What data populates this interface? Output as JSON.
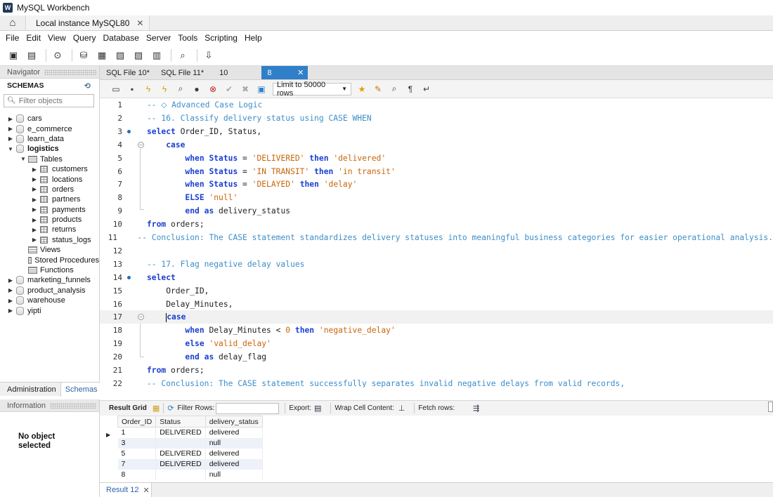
{
  "window": {
    "title": "MySQL Workbench"
  },
  "connection_tab": {
    "label": "Local instance MySQL80",
    "close": "✕"
  },
  "menu": [
    "File",
    "Edit",
    "View",
    "Query",
    "Database",
    "Server",
    "Tools",
    "Scripting",
    "Help"
  ],
  "navigator": {
    "header": "Navigator",
    "schemas_label": "SCHEMAS",
    "filter_placeholder": "Filter objects",
    "schemas": [
      {
        "name": "cars",
        "expanded": false
      },
      {
        "name": "e_commerce",
        "expanded": false
      },
      {
        "name": "learn_data",
        "expanded": false
      },
      {
        "name": "logistics",
        "expanded": true
      },
      {
        "name": "marketing_funnels",
        "expanded": false
      },
      {
        "name": "product_analysis",
        "expanded": false
      },
      {
        "name": "warehouse",
        "expanded": false
      },
      {
        "name": "yipti",
        "expanded": false
      }
    ],
    "logistics": {
      "tables_label": "Tables",
      "tables": [
        "customers",
        "locations",
        "orders",
        "partners",
        "payments",
        "products",
        "returns",
        "status_logs"
      ],
      "views_label": "Views",
      "procedures_label": "Stored Procedures",
      "functions_label": "Functions"
    }
  },
  "nav_tabs": {
    "administration": "Administration",
    "schemas": "Schemas"
  },
  "information": {
    "header": "Information",
    "line1": "No object",
    "line2": "selected"
  },
  "editor_tabs": [
    {
      "label": "SQL File 10*",
      "active": false
    },
    {
      "label": "SQL File 11*",
      "active": false
    },
    {
      "label": "10",
      "active": false
    },
    {
      "label": "8",
      "active": true
    }
  ],
  "editor_tab_close": "✕",
  "editor_toolbar": {
    "limit_label": "Limit to 50000 rows"
  },
  "code_lines": [
    {
      "n": "1",
      "tokens": [
        [
          "cm",
          "-- ⬦ Advanced Case Logic"
        ]
      ]
    },
    {
      "n": "2",
      "tokens": [
        [
          "cm",
          "-- 16. Classify delivery status using CASE WHEN"
        ]
      ]
    },
    {
      "n": "3",
      "dot": true,
      "tokens": [
        [
          "kw",
          "select"
        ],
        [
          "id",
          " Order_ID, Status,"
        ]
      ]
    },
    {
      "n": "4",
      "fold": true,
      "tokens": [
        [
          "id",
          "    "
        ],
        [
          "kw",
          "case"
        ]
      ]
    },
    {
      "n": "5",
      "tokens": [
        [
          "id",
          "        "
        ],
        [
          "kw",
          "when"
        ],
        [
          "kw",
          " Status"
        ],
        [
          "id",
          " = "
        ],
        [
          "str",
          "'DELIVERED'"
        ],
        [
          "id",
          " "
        ],
        [
          "kw",
          "then"
        ],
        [
          "id",
          " "
        ],
        [
          "str",
          "'delivered'"
        ]
      ]
    },
    {
      "n": "6",
      "tokens": [
        [
          "id",
          "        "
        ],
        [
          "kw",
          "when"
        ],
        [
          "kw",
          " Status"
        ],
        [
          "id",
          " = "
        ],
        [
          "str",
          "'IN TRANSIT'"
        ],
        [
          "id",
          " "
        ],
        [
          "kw",
          "then"
        ],
        [
          "id",
          " "
        ],
        [
          "str",
          "'in transit'"
        ]
      ]
    },
    {
      "n": "7",
      "tokens": [
        [
          "id",
          "        "
        ],
        [
          "kw",
          "when"
        ],
        [
          "kw",
          " Status"
        ],
        [
          "id",
          " = "
        ],
        [
          "str",
          "'DELAYED'"
        ],
        [
          "id",
          " "
        ],
        [
          "kw",
          "then"
        ],
        [
          "id",
          " "
        ],
        [
          "str",
          "'delay'"
        ]
      ]
    },
    {
      "n": "8",
      "tokens": [
        [
          "id",
          "        "
        ],
        [
          "kw",
          "ELSE"
        ],
        [
          "id",
          " "
        ],
        [
          "str",
          "'null'"
        ]
      ]
    },
    {
      "n": "9",
      "tokens": [
        [
          "id",
          "        "
        ],
        [
          "kw",
          "end"
        ],
        [
          "id",
          " "
        ],
        [
          "kw",
          "as"
        ],
        [
          "id",
          " delivery_status"
        ]
      ]
    },
    {
      "n": "10",
      "tokens": [
        [
          "kw",
          "from"
        ],
        [
          "id",
          " orders;"
        ]
      ]
    },
    {
      "n": "11",
      "tokens": [
        [
          "cm",
          "-- Conclusion: The CASE statement standardizes delivery statuses into meaningful business categories for easier operational analysis."
        ]
      ]
    },
    {
      "n": "12",
      "tokens": []
    },
    {
      "n": "13",
      "tokens": [
        [
          "cm",
          "-- 17. Flag negative delay values"
        ]
      ]
    },
    {
      "n": "14",
      "dot": true,
      "tokens": [
        [
          "kw",
          "select"
        ]
      ]
    },
    {
      "n": "15",
      "tokens": [
        [
          "id",
          "    Order_ID,"
        ]
      ]
    },
    {
      "n": "16",
      "tokens": [
        [
          "id",
          "    Delay_Minutes,"
        ]
      ]
    },
    {
      "n": "17",
      "fold": true,
      "current": true,
      "caret": true,
      "tokens": [
        [
          "id",
          "    "
        ],
        [
          "kw",
          "case"
        ]
      ]
    },
    {
      "n": "18",
      "tokens": [
        [
          "id",
          "        "
        ],
        [
          "kw",
          "when"
        ],
        [
          "id",
          " Delay_Minutes < "
        ],
        [
          "num",
          "0"
        ],
        [
          "id",
          " "
        ],
        [
          "kw",
          "then"
        ],
        [
          "id",
          " "
        ],
        [
          "str",
          "'negative_delay'"
        ]
      ]
    },
    {
      "n": "19",
      "tokens": [
        [
          "id",
          "        "
        ],
        [
          "kw",
          "else"
        ],
        [
          "id",
          " "
        ],
        [
          "str",
          "'valid_delay'"
        ]
      ]
    },
    {
      "n": "20",
      "tokens": [
        [
          "id",
          "        "
        ],
        [
          "kw",
          "end"
        ],
        [
          "id",
          " "
        ],
        [
          "kw",
          "as"
        ],
        [
          "id",
          " delay_flag"
        ]
      ]
    },
    {
      "n": "21",
      "tokens": [
        [
          "kw",
          "from"
        ],
        [
          "id",
          " orders;"
        ]
      ]
    },
    {
      "n": "22",
      "tokens": [
        [
          "cm",
          "-- Conclusion: The CASE statement successfully separates invalid negative delays from valid records,"
        ]
      ]
    }
  ],
  "result_toolbar": {
    "result_grid": "Result Grid",
    "filter_rows": "Filter Rows:",
    "export": "Export:",
    "wrap": "Wrap Cell Content:",
    "fetch": "Fetch rows:"
  },
  "result_grid": {
    "columns": [
      "Order_ID",
      "Status",
      "delivery_status"
    ],
    "rows": [
      [
        "1",
        "DELIVERED",
        "delivered"
      ],
      [
        "3",
        "",
        "null"
      ],
      [
        "5",
        "DELIVERED",
        "delivered"
      ],
      [
        "7",
        "DELIVERED",
        "delivered"
      ],
      [
        "8",
        "",
        "null"
      ]
    ]
  },
  "result_tab": {
    "label": "Result 12",
    "close": "✕"
  },
  "colors": {
    "accent": "#2f80c8",
    "keyword": "#1a3fd1",
    "string": "#c9650a",
    "comment": "#3d8ec9"
  }
}
